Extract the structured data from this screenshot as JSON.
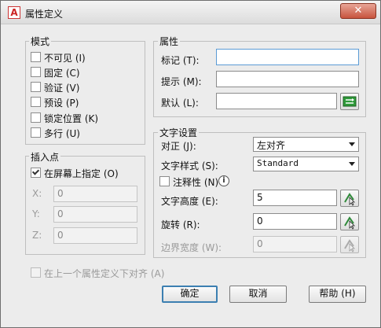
{
  "window": {
    "title": "属性定义",
    "app_icon_text": "A",
    "close_glyph": "✕"
  },
  "mode": {
    "label": "模式",
    "items": [
      {
        "label": "不可见 (I)",
        "checked": false
      },
      {
        "label": "固定 (C)",
        "checked": false
      },
      {
        "label": "验证 (V)",
        "checked": false
      },
      {
        "label": "预设 (P)",
        "checked": false
      },
      {
        "label": "锁定位置 (K)",
        "checked": false
      },
      {
        "label": "多行 (U)",
        "checked": false
      }
    ]
  },
  "insertion": {
    "label": "插入点",
    "specify_on_screen": {
      "label": "在屏幕上指定 (O)",
      "checked": true
    },
    "x": {
      "label": "X:",
      "value": "0"
    },
    "y": {
      "label": "Y:",
      "value": "0"
    },
    "z": {
      "label": "Z:",
      "value": "0"
    }
  },
  "attribute": {
    "label": "属性",
    "tag": {
      "label": "标记 (T):",
      "value": ""
    },
    "prompt": {
      "label": "提示 (M):",
      "value": ""
    },
    "default": {
      "label": "默认 (L):",
      "value": ""
    },
    "insert_field_icon": "insert-field-icon"
  },
  "text_settings": {
    "label": "文字设置",
    "justification": {
      "label": "对正 (J):",
      "value": "左对齐"
    },
    "text_style": {
      "label": "文字样式 (S):",
      "value": "Standard"
    },
    "annotative": {
      "label": "注释性 (N)",
      "checked": false,
      "info_glyph": "i"
    },
    "text_height": {
      "label": "文字高度 (E):",
      "value": "5"
    },
    "rotation": {
      "label": "旋转 (R):",
      "value": "0"
    },
    "boundary_width": {
      "label": "边界宽度 (W):",
      "value": "0"
    }
  },
  "align_below": {
    "label": "在上一个属性定义下对齐 (A)",
    "checked": false
  },
  "buttons": {
    "ok": "确定",
    "cancel": "取消",
    "help": "帮助 (H)"
  }
}
